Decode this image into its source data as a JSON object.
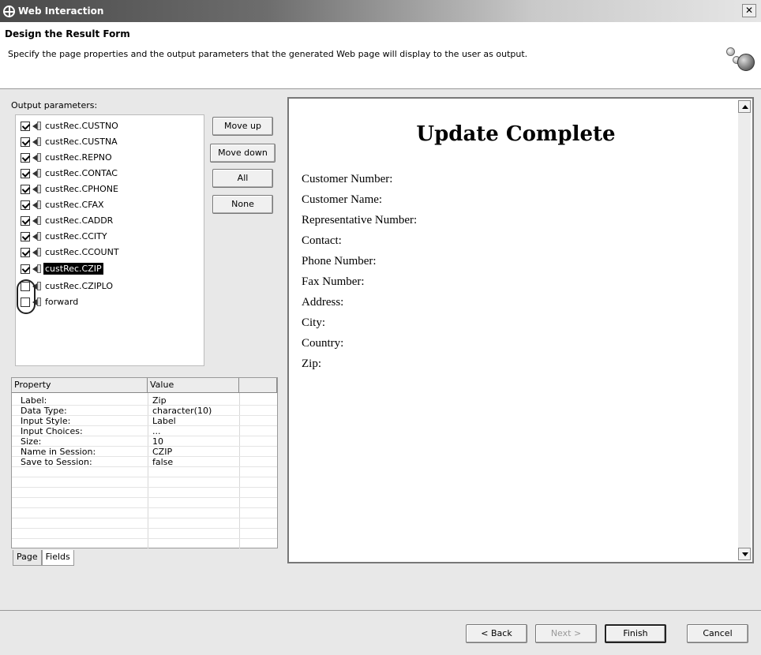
{
  "window": {
    "title": "Web Interaction"
  },
  "header": {
    "title": "Design the Result Form",
    "description": "Specify the page properties and the output parameters that the generated Web page will display to the user as output."
  },
  "output": {
    "label": "Output parameters:",
    "items": [
      {
        "label": "custRec.CUSTNO",
        "checked": true
      },
      {
        "label": "custRec.CUSTNA",
        "checked": true
      },
      {
        "label": "custRec.REPNO",
        "checked": true
      },
      {
        "label": "custRec.CONTAC",
        "checked": true
      },
      {
        "label": "custRec.CPHONE",
        "checked": true
      },
      {
        "label": "custRec.CFAX",
        "checked": true
      },
      {
        "label": "custRec.CADDR",
        "checked": true
      },
      {
        "label": "custRec.CCITY",
        "checked": true
      },
      {
        "label": "custRec.CCOUNT",
        "checked": true
      },
      {
        "label": "custRec.CZIP",
        "checked": true,
        "selected": true
      },
      {
        "label": "custRec.CZIPLO",
        "checked": false
      },
      {
        "label": "forward",
        "checked": false
      }
    ]
  },
  "buttons": {
    "move_up": "Move up",
    "move_down": "Move down",
    "all": "All",
    "none": "None"
  },
  "properties": {
    "col_property": "Property",
    "col_value": "Value",
    "rows": [
      {
        "property": "Label:",
        "value": "Zip"
      },
      {
        "property": "Data Type:",
        "value": "character(10)"
      },
      {
        "property": "Input Style:",
        "value": "Label"
      },
      {
        "property": "Input Choices:",
        "value": "..."
      },
      {
        "property": "Size:",
        "value": "10"
      },
      {
        "property": "Name in Session:",
        "value": "CZIP"
      },
      {
        "property": "Save to Session:",
        "value": "false"
      }
    ]
  },
  "tabs": {
    "page": "Page",
    "fields": "Fields"
  },
  "preview": {
    "title": "Update Complete",
    "fields": [
      "Customer Number:",
      "Customer Name:",
      "Representative Number:",
      "Contact:",
      "Phone Number:",
      "Fax Number:",
      "Address:",
      "City:",
      "Country:",
      "Zip:"
    ]
  },
  "footer": {
    "back": "< Back",
    "next": "Next >",
    "finish": "Finish",
    "cancel": "Cancel"
  }
}
